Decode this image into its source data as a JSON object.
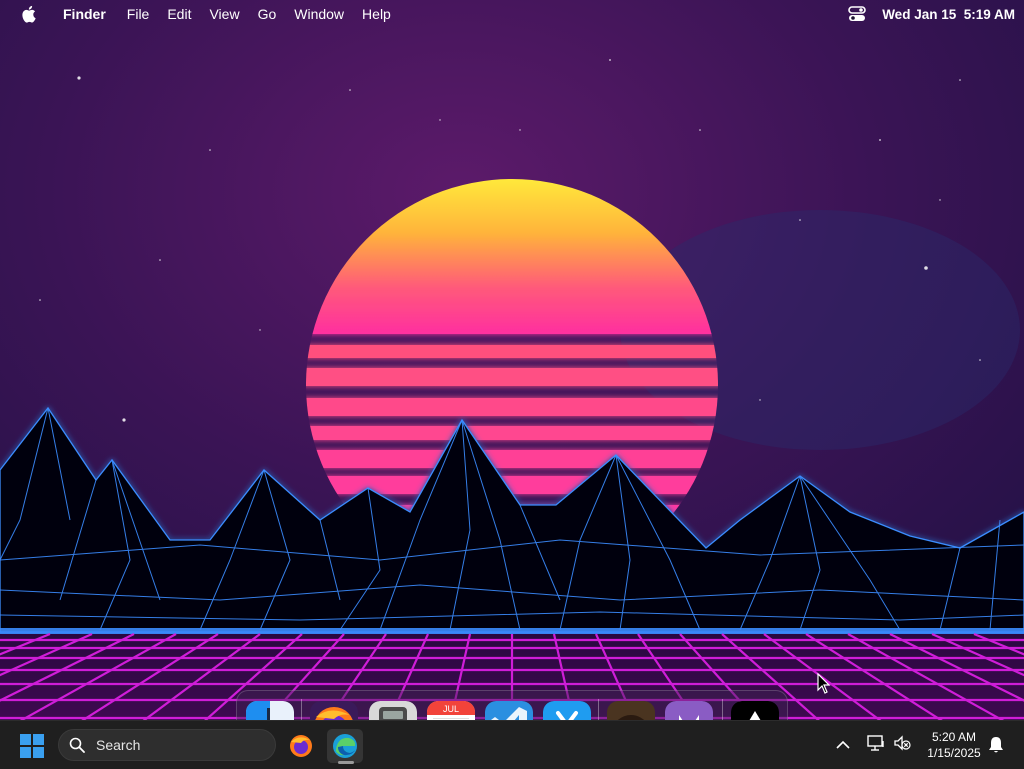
{
  "menubar": {
    "app_name": "Finder",
    "menus": [
      "File",
      "Edit",
      "View",
      "Go",
      "Window",
      "Help"
    ],
    "clock": "Wed Jan 15  5:19 AM"
  },
  "dock": {
    "items": [
      {
        "name": "Finder",
        "icon": "finder-icon"
      },
      {
        "name": "Firefox",
        "icon": "firefox-icon"
      },
      {
        "name": "Calculator",
        "icon": "calculator-icon"
      },
      {
        "name": "Calendar",
        "icon": "calendar-icon",
        "label": "JUL"
      },
      {
        "name": "Visual Studio Code",
        "icon": "vscode-icon"
      },
      {
        "name": "Xcode",
        "icon": "xcode-icon"
      },
      {
        "name": "Photo",
        "icon": "photo-icon"
      },
      {
        "name": "GitHub",
        "icon": "github-icon"
      },
      {
        "name": "Unity",
        "icon": "unity-icon"
      }
    ]
  },
  "taskbar": {
    "search_placeholder": "Search",
    "time": "5:20 AM",
    "date": "1/15/2025",
    "apps": [
      {
        "name": "Firefox",
        "icon": "firefox-icon",
        "active": false
      },
      {
        "name": "Microsoft Edge",
        "icon": "edge-icon",
        "active": true
      }
    ]
  },
  "colors": {
    "sky_top": "#1b0d35",
    "sky_mid": "#5a1a68",
    "sun_top": "#ffe93a",
    "sun_bottom": "#ff3d8f",
    "mountain_line": "#3b8cff",
    "grid_line": "#d81fe0",
    "taskbar_bg": "#1f1f1f"
  }
}
